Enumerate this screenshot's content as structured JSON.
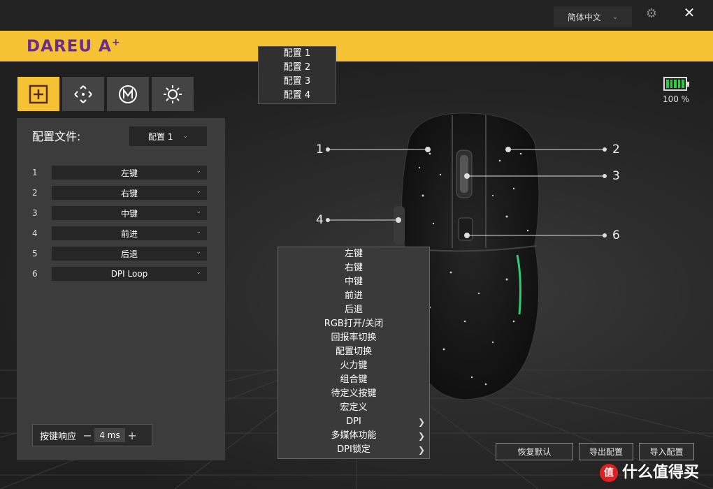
{
  "topbar": {
    "language": "简体中文",
    "settings_icon": "gear-icon",
    "close_icon": "close-icon"
  },
  "brand": {
    "logo_text": "DAREU",
    "logo_mark": "A",
    "logo_plus": "+"
  },
  "tabs": [
    {
      "icon": "plus-square-icon",
      "active": true
    },
    {
      "icon": "dpi-arrows-icon",
      "active": false
    },
    {
      "icon": "macro-m-icon",
      "active": false
    },
    {
      "icon": "sun-light-icon",
      "active": false
    }
  ],
  "profile": {
    "label": "配置文件:",
    "selected": "配置 1",
    "options": [
      "配置 1",
      "配置 2",
      "配置 3",
      "配置 4"
    ]
  },
  "keys": [
    {
      "num": "1",
      "value": "左键"
    },
    {
      "num": "2",
      "value": "右键"
    },
    {
      "num": "3",
      "value": "中键"
    },
    {
      "num": "4",
      "value": "前进"
    },
    {
      "num": "5",
      "value": "后退"
    },
    {
      "num": "6",
      "value": "DPI Loop"
    }
  ],
  "response": {
    "label": "按键响应",
    "value": "4 ms",
    "minus": "−",
    "plus": "+"
  },
  "function_menu": [
    {
      "label": "左键",
      "submenu": false
    },
    {
      "label": "右键",
      "submenu": false
    },
    {
      "label": "中键",
      "submenu": false
    },
    {
      "label": "前进",
      "submenu": false
    },
    {
      "label": "后退",
      "submenu": false
    },
    {
      "label": "RGB打开/关闭",
      "submenu": false
    },
    {
      "label": "回报率切换",
      "submenu": false
    },
    {
      "label": "配置切换",
      "submenu": false
    },
    {
      "label": "火力键",
      "submenu": false
    },
    {
      "label": "组合键",
      "submenu": false
    },
    {
      "label": "待定义按键",
      "submenu": false
    },
    {
      "label": "宏定义",
      "submenu": false
    },
    {
      "label": "DPI",
      "submenu": true
    },
    {
      "label": "多媒体功能",
      "submenu": true
    },
    {
      "label": "DPI锁定",
      "submenu": true
    }
  ],
  "battery": {
    "level": 1.0,
    "text": "100 %",
    "color": "#2ecc40"
  },
  "callouts": [
    "1",
    "2",
    "3",
    "4",
    "6"
  ],
  "buttons": {
    "restore": "恢复默认",
    "export": "导出配置",
    "import": "导入配置"
  },
  "watermark": {
    "icon_text": "值",
    "text": "什么值得买"
  },
  "colors": {
    "accent": "#f4c233",
    "brand_purple": "#6a2d8c"
  }
}
